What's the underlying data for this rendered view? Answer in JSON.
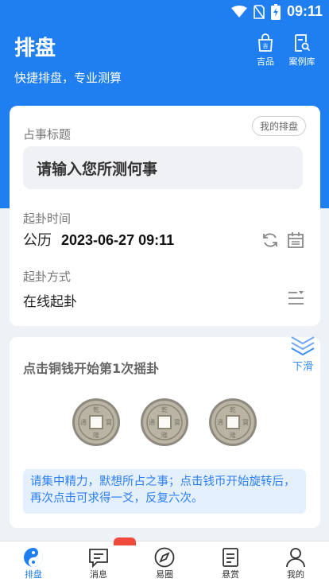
{
  "status_bar": {
    "time": "09:11"
  },
  "header": {
    "title": "排盘",
    "subtitle": "快捷排盘，专业测算",
    "buttons": [
      {
        "label": "吉品",
        "icon": "shopping-bag-icon"
      },
      {
        "label": "案例库",
        "icon": "case-search-icon"
      }
    ]
  },
  "divination_form": {
    "my_chart_button": "我的排盘",
    "subject_label": "占事标题",
    "subject_placeholder": "请输入您所测何事",
    "time_label": "起卦时间",
    "calendar_type": "公历",
    "datetime": "2023-06-27 09:11",
    "method_label": "起卦方式",
    "method_value": "在线起卦"
  },
  "coin_shake": {
    "title": "点击铜钱开始第1次摇卦",
    "scroll_hint": "下滑",
    "coins": [
      "coin-1",
      "coin-2",
      "coin-3"
    ],
    "instruction": "请集中精力，默想所占之事；点击钱币开始旋转后，再次点击可求得一爻，反复六次。"
  },
  "tab_bar": {
    "active": "排盘",
    "tabs": [
      {
        "label": "排盘",
        "icon": "yin-yang-icon"
      },
      {
        "label": "消息",
        "icon": "message-icon"
      },
      {
        "label": "易圈",
        "icon": "compass-icon"
      },
      {
        "label": "悬赏",
        "icon": "document-icon"
      },
      {
        "label": "我的",
        "icon": "user-icon"
      }
    ]
  },
  "colors": {
    "primary": "#1f7ff0",
    "tip_bg": "#e5f0ff",
    "badge": "#f04a3c"
  }
}
